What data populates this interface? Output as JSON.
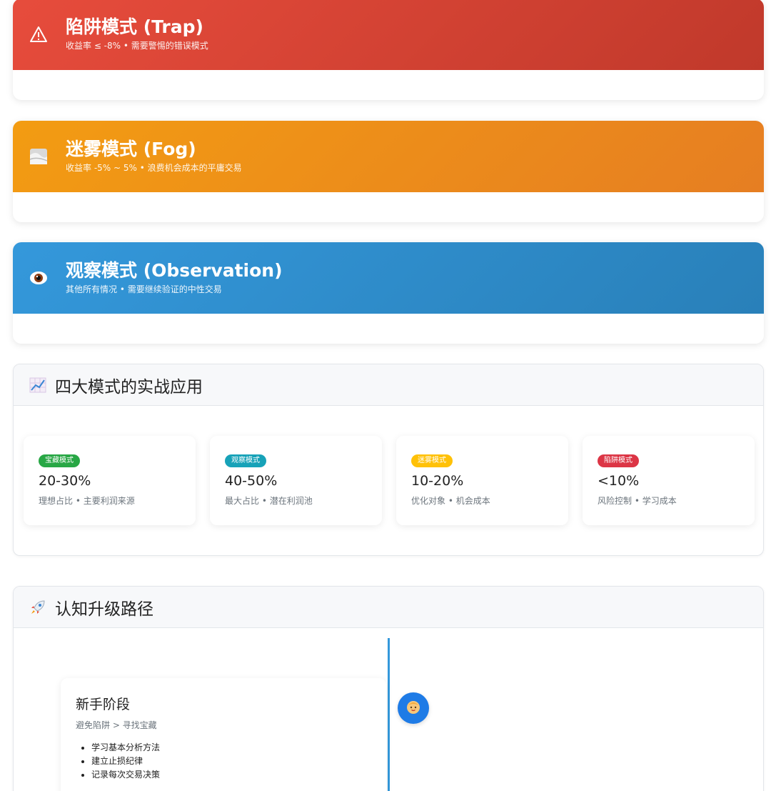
{
  "modes": {
    "trap": {
      "title": "陷阱模式 (Trap)",
      "subtitle": "收益率 ≤ -8% • 需要警惕的错误模式",
      "icon": "warning-icon"
    },
    "fog": {
      "title": "迷雾模式 (Fog)",
      "subtitle": "收益率 -5% ~ 5% • 浪费机会成本的平庸交易",
      "icon": "fog-icon"
    },
    "observation": {
      "title": "观察模式 (Observation)",
      "subtitle": "其他所有情况 • 需要继续验证的中性交易",
      "icon": "eye-icon"
    }
  },
  "applications": {
    "title": "四大模式的实战应用",
    "icon": "chart-icon",
    "cards": [
      {
        "badge": "宝藏模式",
        "value": "20-30%",
        "desc": "理想占比 • 主要利润来源",
        "color": "#28a745"
      },
      {
        "badge": "观察模式",
        "value": "40-50%",
        "desc": "最大占比 • 潜在利润池",
        "color": "#17a2b8"
      },
      {
        "badge": "迷雾模式",
        "value": "10-20%",
        "desc": "优化对象 • 机会成本",
        "color": "#ffc107"
      },
      {
        "badge": "陷阱模式",
        "value": "<10%",
        "desc": "风险控制 • 学习成本",
        "color": "#dc3545"
      }
    ]
  },
  "path": {
    "title": "认知升级路径",
    "icon": "rocket-icon",
    "stage": {
      "title": "新手阶段",
      "subtitle": "避免陷阱 > 寻找宝藏",
      "items": [
        "学习基本分析方法",
        "建立止损纪律",
        "记录每次交易决策"
      ],
      "avatar": "baby-icon"
    }
  }
}
